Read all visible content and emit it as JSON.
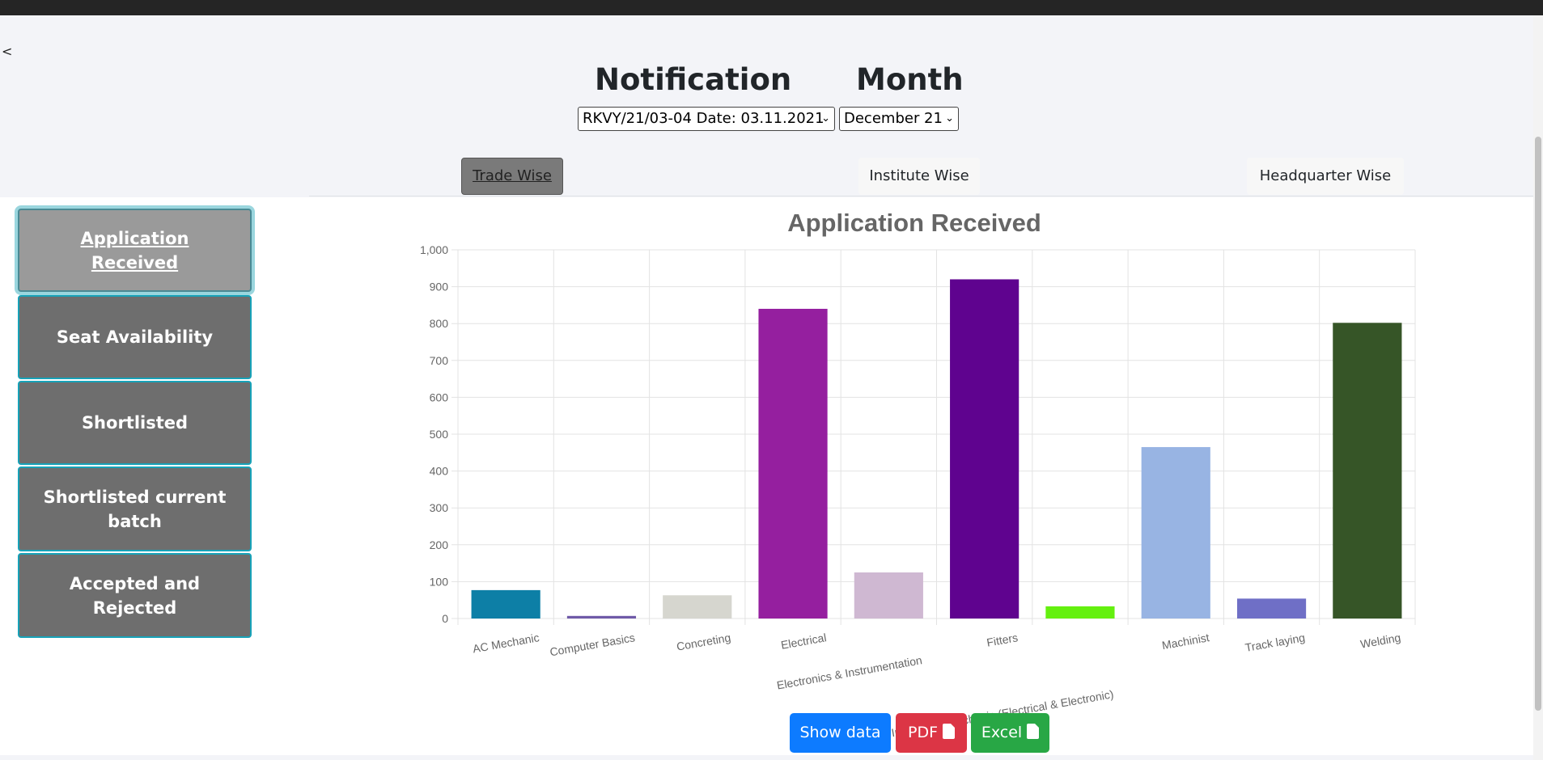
{
  "back_label": "<",
  "filters": {
    "notification_label": "Notification",
    "month_label": "Month",
    "notification_value": "RKVY/21/03-04 Date: 03.11.2021",
    "month_value": "December 21"
  },
  "tabs": [
    {
      "label": "Trade Wise",
      "active": true
    },
    {
      "label": "Institute Wise",
      "active": false
    },
    {
      "label": "Headquarter Wise",
      "active": false
    }
  ],
  "sidebar": {
    "items": [
      {
        "label": "Application Received",
        "active": true
      },
      {
        "label": "Seat Availability",
        "active": false
      },
      {
        "label": "Shortlisted",
        "active": false
      },
      {
        "label": "Shortlisted current batch",
        "active": false
      },
      {
        "label": "Accepted and Rejected",
        "active": false
      }
    ]
  },
  "chart_data": {
    "type": "bar",
    "title": "Application Received",
    "categories": [
      "AC Mechanic",
      "Computer Basics",
      "Concreting",
      "Electrical",
      "Electronics & Instrumentation",
      "Fitters",
      "Instrument Mechanic (Electrical & Electronic)",
      "Machinist",
      "Track laying",
      "Welding"
    ],
    "values": [
      77,
      7,
      63,
      840,
      125,
      920,
      33,
      465,
      54,
      802
    ],
    "colors": [
      "#0d7fa6",
      "#6f5aa8",
      "#d6d6cf",
      "#951f9f",
      "#cfb8d2",
      "#5f038f",
      "#64f00f",
      "#98b4e3",
      "#6f6fc6",
      "#365527"
    ],
    "ylim": [
      0,
      1000
    ],
    "yticks": [
      "0",
      "100",
      "200",
      "300",
      "400",
      "500",
      "600",
      "700",
      "800",
      "900",
      "1,000"
    ],
    "grid": true,
    "legend": "none"
  },
  "actions": {
    "show_data": "Show data",
    "pdf": "PDF",
    "excel": "Excel"
  },
  "colors": {
    "show_data": "#0d7bff",
    "pdf": "#dc3545",
    "excel": "#28a745",
    "accent": "#17a2b8"
  }
}
